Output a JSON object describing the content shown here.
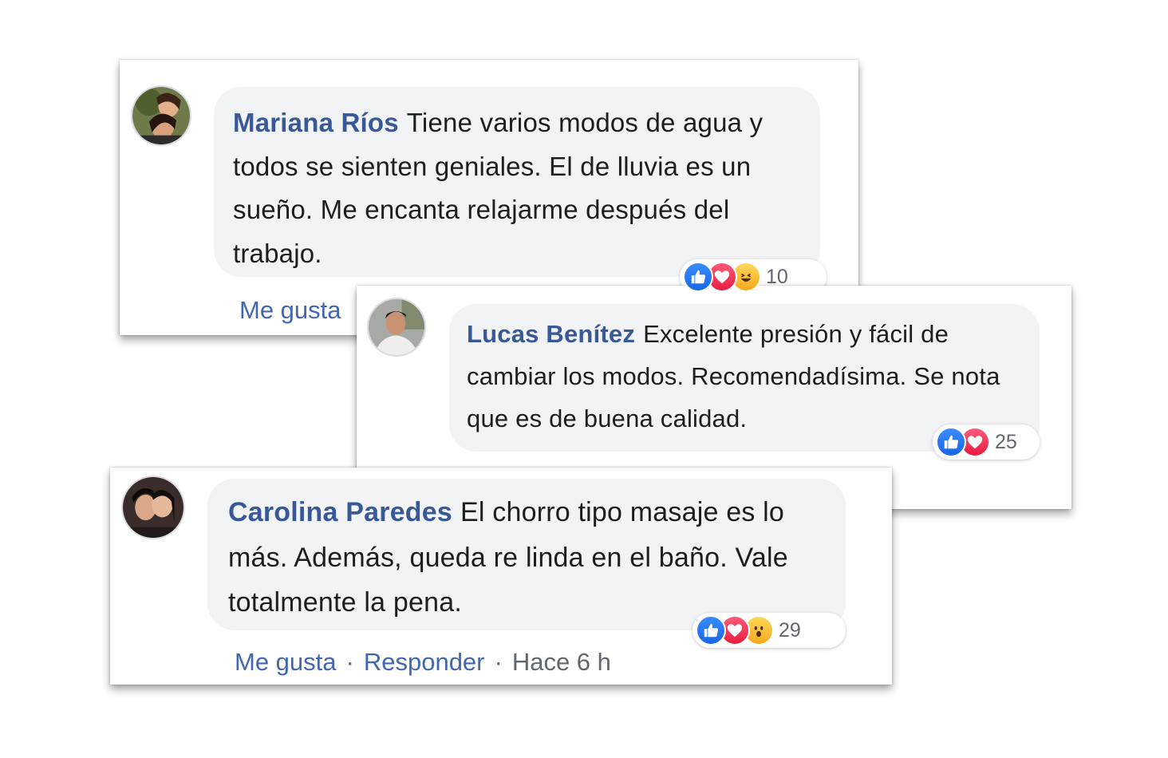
{
  "comments": [
    {
      "author": "Mariana Ríos",
      "text": "Tiene varios modos de agua y todos se sienten geniales. El de lluvia es un sueño. Me encanta relajarme después del trabajo.",
      "reaction_count": "10",
      "reaction_icons": [
        "like-icon",
        "love-icon",
        "haha-icon"
      ],
      "like_label": "Me gusta"
    },
    {
      "author": "Lucas Benítez",
      "text": "Excelente presión y fácil de cambiar los modos. Recomendadísima. Se nota que es de buena calidad.",
      "reaction_count": "25",
      "reaction_icons": [
        "like-icon",
        "love-icon"
      ]
    },
    {
      "author": "Carolina Paredes",
      "text": "El chorro tipo masaje es lo más. Además, queda re linda en el baño. Vale totalmente la pena.",
      "reaction_count": "29",
      "reaction_icons": [
        "like-icon",
        "love-icon",
        "wow-icon"
      ],
      "like_label": "Me gusta",
      "separator": "·",
      "reply_label": "Responder",
      "timestamp": "Hace 6 h"
    }
  ],
  "colors": {
    "author": "#385898",
    "link": "#4267b2",
    "bubble": "#f2f3f5",
    "like": "#1766e6",
    "love": "#e81c3f"
  }
}
